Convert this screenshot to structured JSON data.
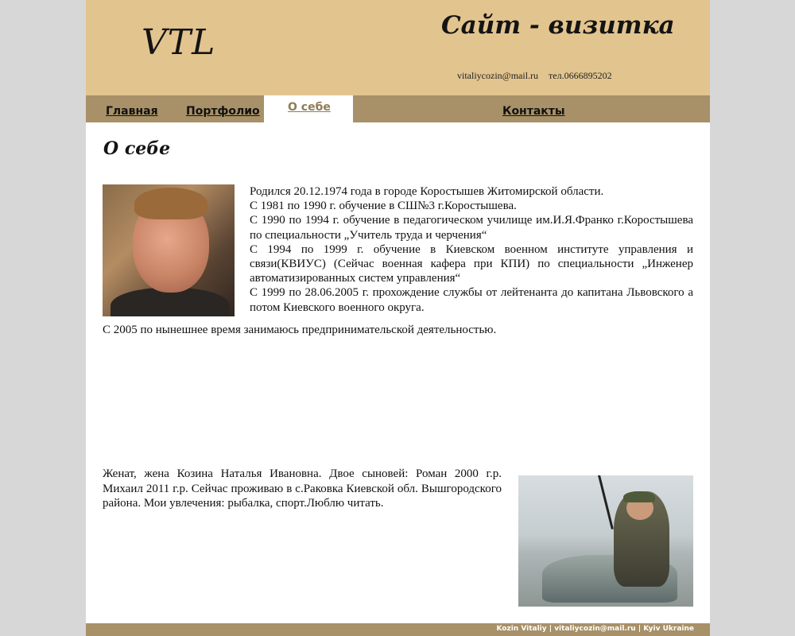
{
  "header": {
    "logo": "VTL",
    "site_title": "Сайт - визитка",
    "email": "vitaliycozin@mail.ru",
    "phone": "тел.0666895202"
  },
  "nav": {
    "items": [
      {
        "label": "Главная"
      },
      {
        "label": "Портфолио"
      },
      {
        "label": "О себе",
        "active": true
      },
      {
        "label": "Контакты"
      }
    ]
  },
  "content": {
    "title": "О себе",
    "bio": [
      "Родился 20.12.1974 года в городе Коростышев Житомирской области.",
      "С 1981 по 1990 г. обучение в СШ№3 г.Коростышева.",
      "С 1990 по 1994 г. обучение в педагогическом училище им.И.Я.Франко г.Коростышева по специальности „Учитель труда и черчения“",
      "С 1994 по 1999 г. обучение в Киевском военном институте управления и связи(КВИУС) (Сейчас военная кафера при КПИ) по специальности „Инженер автоматизированных систем управления“",
      "С 1999 по 28.06.2005 г. прохождение службы от лейтенанта до капитана Львовского а потом Киевского военного округа."
    ],
    "bio_last": "С 2005 по нынешнее время занимаюсь предпринимательской деятельностью.",
    "family": "Женат, жена Козина Наталья Ивановна. Двое сыновей: Роман 2000 г.р. Михаил 2011 г.р. Сейчас проживаю в с.Раковка Киевской обл. Вышгородского района. Мои увлечения: рыбалка, спорт.Люблю читать."
  },
  "footer": {
    "text": "Kozin Vitaliy | vitaliycozin@mail.ru | Kyiv Ukraine"
  }
}
